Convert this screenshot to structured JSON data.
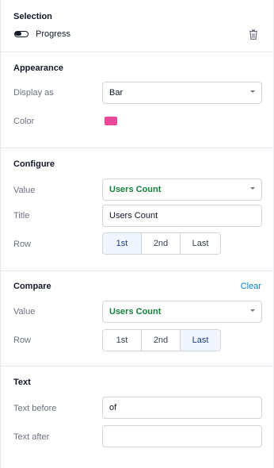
{
  "selection": {
    "title": "Selection",
    "item_name": "Progress",
    "icons": {
      "item": "toggle-icon",
      "delete": "trash-icon"
    }
  },
  "appearance": {
    "title": "Appearance",
    "display_as_label": "Display as",
    "display_as_value": "Bar",
    "color_label": "Color",
    "color_value": "#ec4899"
  },
  "configure": {
    "title": "Configure",
    "value_label": "Value",
    "value_selected": "Users Count",
    "title_label": "Title",
    "title_value": "Users Count",
    "row_label": "Row",
    "row_options": [
      "1st",
      "2nd",
      "Last"
    ],
    "row_selected": "1st"
  },
  "compare": {
    "title": "Compare",
    "clear_label": "Clear",
    "value_label": "Value",
    "value_selected": "Users Count",
    "row_label": "Row",
    "row_options": [
      "1st",
      "2nd",
      "Last"
    ],
    "row_selected": "Last"
  },
  "text": {
    "title": "Text",
    "before_label": "Text before",
    "before_value": "of",
    "after_label": "Text after",
    "after_value": ""
  },
  "colors": {
    "accent_green": "#15803d",
    "link_blue": "#0284c7",
    "active_segment_bg": "#eff6ff"
  }
}
